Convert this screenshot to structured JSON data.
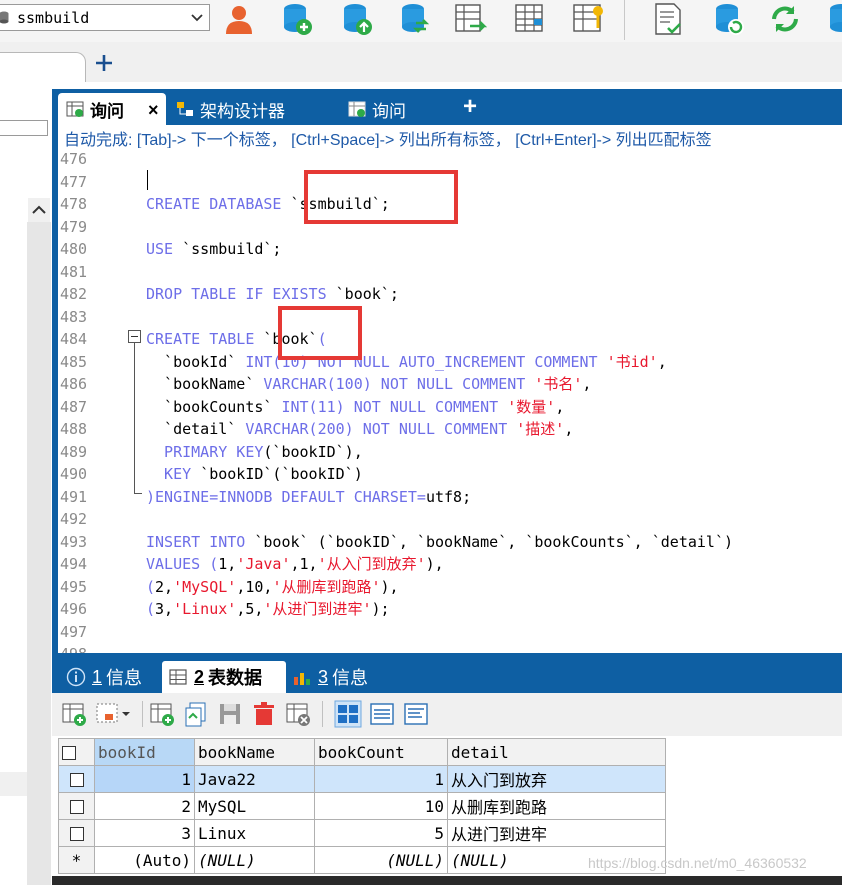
{
  "toolbar": {
    "database_select": "ssmbuild",
    "icons": [
      "user-icon",
      "database-add-icon",
      "database-upload-icon",
      "database-sync-icon",
      "table-export-icon",
      "table-grid-icon",
      "table-key-icon",
      "document-check-icon",
      "database-refresh-icon",
      "green-refresh-icon",
      "database-icon"
    ]
  },
  "connection_tabs": {
    "add_label": "+"
  },
  "editor_tabs": {
    "tabs": [
      {
        "label": "询问",
        "close": "×"
      },
      {
        "label": "架构设计器"
      },
      {
        "label": "询问"
      }
    ],
    "add_label": "+"
  },
  "hint": "自动完成: [Tab]-> 下一个标签， [Ctrl+Space]-> 列出所有标签， [Ctrl+Enter]-> 列出匹配标签",
  "code_lines": [
    {
      "n": "476",
      "tokens": []
    },
    {
      "n": "477",
      "tokens": []
    },
    {
      "n": "478",
      "tokens": [
        {
          "t": "CREATE DATABASE ",
          "c": "kw"
        },
        {
          "t": "`ssmbuild`;",
          "c": "plain"
        }
      ]
    },
    {
      "n": "479",
      "tokens": []
    },
    {
      "n": "480",
      "tokens": [
        {
          "t": "USE ",
          "c": "kw"
        },
        {
          "t": "`ssmbuild`;",
          "c": "plain"
        }
      ]
    },
    {
      "n": "481",
      "tokens": []
    },
    {
      "n": "482",
      "tokens": [
        {
          "t": "DROP TABLE IF EXISTS ",
          "c": "kw"
        },
        {
          "t": "`book`;",
          "c": "plain"
        }
      ]
    },
    {
      "n": "483",
      "tokens": []
    },
    {
      "n": "484",
      "tokens": [
        {
          "t": "CREATE TABLE ",
          "c": "kw"
        },
        {
          "t": "`book`",
          "c": "plain"
        },
        {
          "t": "(",
          "c": "kw"
        }
      ]
    },
    {
      "n": "485",
      "tokens": [
        {
          "t": "  `bookId` ",
          "c": "plain"
        },
        {
          "t": "INT(10) NOT NULL AUTO_INCREMENT COMMENT ",
          "c": "kw"
        },
        {
          "t": "'书id'",
          "c": "str"
        },
        {
          "t": ",",
          "c": "plain"
        }
      ]
    },
    {
      "n": "486",
      "tokens": [
        {
          "t": "  `bookName` ",
          "c": "plain"
        },
        {
          "t": "VARCHAR(100) NOT NULL COMMENT ",
          "c": "kw"
        },
        {
          "t": "'书名'",
          "c": "str"
        },
        {
          "t": ",",
          "c": "plain"
        }
      ]
    },
    {
      "n": "487",
      "tokens": [
        {
          "t": "  `bookCounts` ",
          "c": "plain"
        },
        {
          "t": "INT(11) NOT NULL COMMENT ",
          "c": "kw"
        },
        {
          "t": "'数量'",
          "c": "str"
        },
        {
          "t": ",",
          "c": "plain"
        }
      ]
    },
    {
      "n": "488",
      "tokens": [
        {
          "t": "  `detail` ",
          "c": "plain"
        },
        {
          "t": "VARCHAR(200) NOT NULL COMMENT ",
          "c": "kw"
        },
        {
          "t": "'描述'",
          "c": "str"
        },
        {
          "t": ",",
          "c": "plain"
        }
      ]
    },
    {
      "n": "489",
      "tokens": [
        {
          "t": "  PRIMARY KEY",
          "c": "kw"
        },
        {
          "t": "(`bookID`),",
          "c": "plain"
        }
      ]
    },
    {
      "n": "490",
      "tokens": [
        {
          "t": "  KEY ",
          "c": "kw"
        },
        {
          "t": "`bookID`(`bookID`)",
          "c": "plain"
        }
      ]
    },
    {
      "n": "491",
      "tokens": [
        {
          "t": ")ENGINE=INNODB DEFAULT CHARSET=",
          "c": "kw"
        },
        {
          "t": "utf8;",
          "c": "plain"
        }
      ]
    },
    {
      "n": "492",
      "tokens": []
    },
    {
      "n": "493",
      "tokens": [
        {
          "t": "INSERT INTO ",
          "c": "kw"
        },
        {
          "t": "`book` (`bookID`, `bookName`, `bookCounts`, `detail`)",
          "c": "plain"
        }
      ]
    },
    {
      "n": "494",
      "tokens": [
        {
          "t": "VALUES (",
          "c": "kw"
        },
        {
          "t": "1,",
          "c": "plain"
        },
        {
          "t": "'Java'",
          "c": "str"
        },
        {
          "t": ",1,",
          "c": "plain"
        },
        {
          "t": "'从入门到放弃'",
          "c": "str"
        },
        {
          "t": "),",
          "c": "plain"
        }
      ]
    },
    {
      "n": "495",
      "tokens": [
        {
          "t": "(",
          "c": "kw"
        },
        {
          "t": "2,",
          "c": "plain"
        },
        {
          "t": "'MySQL'",
          "c": "str"
        },
        {
          "t": ",10,",
          "c": "plain"
        },
        {
          "t": "'从删库到跑路'",
          "c": "str"
        },
        {
          "t": "),",
          "c": "plain"
        }
      ]
    },
    {
      "n": "496",
      "tokens": [
        {
          "t": "(",
          "c": "kw"
        },
        {
          "t": "3,",
          "c": "plain"
        },
        {
          "t": "'Linux'",
          "c": "str"
        },
        {
          "t": ",5,",
          "c": "plain"
        },
        {
          "t": "'从进门到进牢'",
          "c": "str"
        },
        {
          "t": ");",
          "c": "plain"
        }
      ]
    },
    {
      "n": "497",
      "tokens": []
    },
    {
      "n": "498",
      "tokens": []
    }
  ],
  "result_tabs": [
    {
      "num": "1",
      "label": "信息"
    },
    {
      "num": "2",
      "label": "表数据"
    },
    {
      "num": "3",
      "label": "信息"
    }
  ],
  "result_toolbar_icons": [
    "insert-row-icon",
    "filter-dropdown-icon",
    "add-row-icon",
    "copy-icon",
    "save-icon",
    "delete-icon",
    "refresh-grid-icon",
    "grid-view-icon",
    "form-view-icon",
    "text-view-icon"
  ],
  "grid": {
    "columns": [
      "bookId",
      "bookName",
      "bookCount",
      "detail"
    ],
    "rows": [
      [
        "1",
        "Java22",
        "1",
        "从入门到放弃"
      ],
      [
        "2",
        "MySQL",
        "10",
        "从删库到跑路"
      ],
      [
        "3",
        "Linux",
        "5",
        "从进门到进牢"
      ]
    ],
    "new_row": [
      "(Auto)",
      "(NULL)",
      "(NULL)",
      "(NULL)"
    ],
    "new_row_marker": "*"
  },
  "watermark": "https://blog.csdn.net/m0_46360532",
  "colors": {
    "accent": "#0e5fa3",
    "keyword": "#6d6ee8",
    "string": "#e8182e",
    "highlight": "#e53935"
  }
}
